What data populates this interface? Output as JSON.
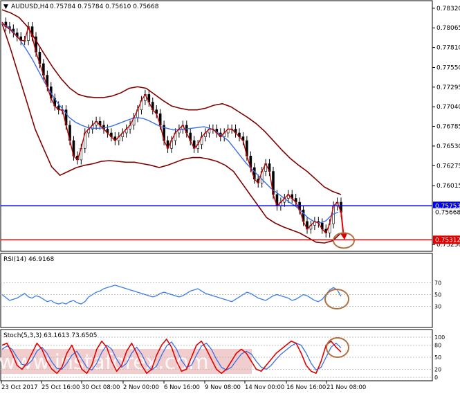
{
  "window": {
    "symbol_label": "AUDUSD,H4",
    "ohlc_label": "0.75784 0.75784 0.75610 0.75668"
  },
  "colors": {
    "price": "#c00000",
    "ma_blue": "#3a6ee8",
    "bollinger": "#800000",
    "resistance_line": "#0000ee",
    "support_line": "#e00000",
    "rsi_line": "#3a7ee8",
    "stoch_main": "#e00000",
    "stoch_signal": "#3a6ee8",
    "annotation_circle": "#b07040",
    "price_tag_blue": "#0000ee",
    "price_tag_red": "#e00000",
    "watermark": "#e09090"
  },
  "chart_data": [
    {
      "type": "line",
      "title": "AUDUSD,H4",
      "series": [
        {
          "name": "Price",
          "values": [
            0.7814,
            0.7808,
            0.7805,
            0.78,
            0.7795,
            0.779,
            0.779,
            0.7808,
            0.7795,
            0.7775,
            0.776,
            0.7745,
            0.773,
            0.7715,
            0.7705,
            0.77,
            0.77,
            0.768,
            0.766,
            0.764,
            0.7635,
            0.765,
            0.767,
            0.7675,
            0.768,
            0.7685,
            0.768,
            0.7675,
            0.767,
            0.7665,
            0.766,
            0.7665,
            0.767,
            0.7675,
            0.768,
            0.769,
            0.77,
            0.7712,
            0.772,
            0.771,
            0.77,
            0.7695,
            0.768,
            0.766,
            0.765,
            0.766,
            0.767,
            0.7675,
            0.768,
            0.767,
            0.766,
            0.765,
            0.7655,
            0.7665,
            0.767,
            0.7675,
            0.7675,
            0.767,
            0.7665,
            0.767,
            0.7675,
            0.7675,
            0.767,
            0.7665,
            0.766,
            0.764,
            0.7625,
            0.761,
            0.7605,
            0.762,
            0.763,
            0.762,
            0.759,
            0.7575,
            0.758,
            0.7585,
            0.759,
            0.7585,
            0.758,
            0.757,
            0.7555,
            0.7545,
            0.755,
            0.7555,
            0.7553,
            0.7545,
            0.754,
            0.7552,
            0.7575,
            0.758,
            0.7567
          ]
        },
        {
          "name": "MA",
          "values": [
            0.7812,
            0.7808,
            0.78,
            0.779,
            0.7778,
            0.7765,
            0.775,
            0.7735,
            0.7722,
            0.771,
            0.77,
            0.769,
            0.7684,
            0.768,
            0.7677,
            0.7676,
            0.7676,
            0.7677,
            0.7679,
            0.7682,
            0.7685,
            0.7688,
            0.769,
            0.7689,
            0.7686,
            0.7682,
            0.7678,
            0.7676,
            0.7674,
            0.7674,
            0.7675,
            0.7676,
            0.7677,
            0.7678,
            0.7676,
            0.7672,
            0.7666,
            0.766,
            0.765,
            0.764,
            0.763,
            0.7622,
            0.7614,
            0.7606,
            0.7598,
            0.7592,
            0.7586,
            0.758,
            0.7575,
            0.7568,
            0.756,
            0.7555,
            0.7553,
            0.7556,
            0.7564,
            0.7567
          ]
        },
        {
          "name": "Bollinger Upper",
          "values": [
            0.783,
            0.7826,
            0.782,
            0.7808,
            0.779,
            0.7772,
            0.7755,
            0.774,
            0.7728,
            0.772,
            0.7717,
            0.7716,
            0.7716,
            0.7718,
            0.7722,
            0.7728,
            0.773,
            0.7728,
            0.772,
            0.7712,
            0.7705,
            0.7702,
            0.77,
            0.77,
            0.7702,
            0.7706,
            0.7708,
            0.7704,
            0.7697,
            0.769,
            0.7682,
            0.7672,
            0.766,
            0.7648,
            0.7637,
            0.7628,
            0.762,
            0.761,
            0.76,
            0.7594,
            0.759
          ]
        },
        {
          "name": "Bollinger Lower",
          "values": [
            0.7812,
            0.778,
            0.7745,
            0.771,
            0.7675,
            0.765,
            0.7626,
            0.7615,
            0.762,
            0.7625,
            0.7628,
            0.763,
            0.7633,
            0.7634,
            0.7633,
            0.7632,
            0.7632,
            0.763,
            0.7628,
            0.7625,
            0.7628,
            0.7632,
            0.7636,
            0.7638,
            0.7638,
            0.7636,
            0.7633,
            0.7628,
            0.762,
            0.7605,
            0.759,
            0.7575,
            0.756,
            0.7553,
            0.7548,
            0.7544,
            0.754,
            0.7534,
            0.7528,
            0.7527,
            0.753,
            0.754
          ]
        }
      ],
      "price_labels": [
        "0.78320",
        "0.78065",
        "0.77810",
        "0.77550",
        "0.77295",
        "0.77040",
        "0.76785",
        "0.76530",
        "0.76275",
        "0.76015",
        "0.75250"
      ],
      "levels": [
        {
          "price": 0.75753,
          "label": "0.75753",
          "color": "#0000ee"
        },
        {
          "price": 0.75312,
          "label": "0.75312",
          "color": "#e00000"
        }
      ],
      "current_price": {
        "price": 0.75668,
        "label": "0.75668"
      },
      "ylim": [
        0.7518,
        0.784
      ]
    },
    {
      "type": "line",
      "title": "RSI(14) 46.9168",
      "series": [
        {
          "name": "RSI",
          "values": [
            50,
            45,
            40,
            42,
            44,
            48,
            52,
            46,
            44,
            48,
            46,
            42,
            38,
            40,
            36,
            34,
            36,
            34,
            38,
            40,
            36,
            34,
            38,
            46,
            50,
            54,
            56,
            60,
            62,
            64,
            66,
            64,
            62,
            60,
            58,
            56,
            54,
            52,
            50,
            48,
            46,
            48,
            52,
            54,
            52,
            50,
            48,
            46,
            48,
            52,
            56,
            58,
            60,
            56,
            52,
            50,
            48,
            46,
            44,
            42,
            40,
            38,
            42,
            46,
            50,
            54,
            52,
            48,
            44,
            42,
            40,
            44,
            48,
            50,
            48,
            46,
            44,
            40,
            42,
            46,
            50,
            48,
            44,
            40,
            38,
            42,
            50,
            58,
            62,
            58,
            46.9
          ]
        }
      ],
      "levels": [
        "70",
        "50",
        "30"
      ],
      "ylim": [
        0,
        100
      ]
    },
    {
      "type": "line",
      "title": "Stoch(5,3,3) 63.1613 73.6505",
      "series": [
        {
          "name": "Stoch Main",
          "values": [
            80,
            85,
            60,
            30,
            20,
            35,
            60,
            85,
            70,
            40,
            20,
            10,
            25,
            60,
            80,
            50,
            20,
            10,
            30,
            70,
            90,
            75,
            40,
            15,
            30,
            65,
            85,
            60,
            30,
            10,
            20,
            55,
            80,
            95,
            75,
            40,
            15,
            20,
            50,
            80,
            90,
            70,
            45,
            20,
            10,
            20,
            40,
            60,
            70,
            60,
            40,
            20,
            15,
            30,
            45,
            60,
            70,
            80,
            90,
            85,
            60,
            30,
            15,
            10,
            40,
            80,
            90,
            75,
            63.2
          ]
        },
        {
          "name": "Stoch Signal",
          "values": [
            70,
            78,
            70,
            50,
            32,
            30,
            42,
            65,
            75,
            60,
            38,
            22,
            20,
            35,
            55,
            65,
            45,
            25,
            18,
            35,
            62,
            80,
            70,
            45,
            25,
            35,
            60,
            75,
            58,
            32,
            18,
            28,
            55,
            78,
            88,
            70,
            42,
            25,
            30,
            55,
            78,
            85,
            70,
            45,
            25,
            18,
            25,
            42,
            58,
            65,
            58,
            40,
            25,
            20,
            30,
            45,
            58,
            68,
            78,
            85,
            80,
            60,
            35,
            18,
            25,
            50,
            75,
            85,
            73.7
          ]
        }
      ],
      "levels": [
        "100",
        "80",
        "50",
        "20",
        "0"
      ],
      "ylim": [
        0,
        100
      ]
    }
  ],
  "time_axis": {
    "labels": [
      "23 Oct 2017",
      "25 Oct 16:00",
      "30 Oct 08:00",
      "2 Nov 00:00",
      "6 Nov 16:00",
      "9 Nov 08:00",
      "14 Nov 00:00",
      "16 Nov 16:00",
      "21 Nov 08:00"
    ]
  },
  "watermark": {
    "text": "www.instaforex.com"
  }
}
